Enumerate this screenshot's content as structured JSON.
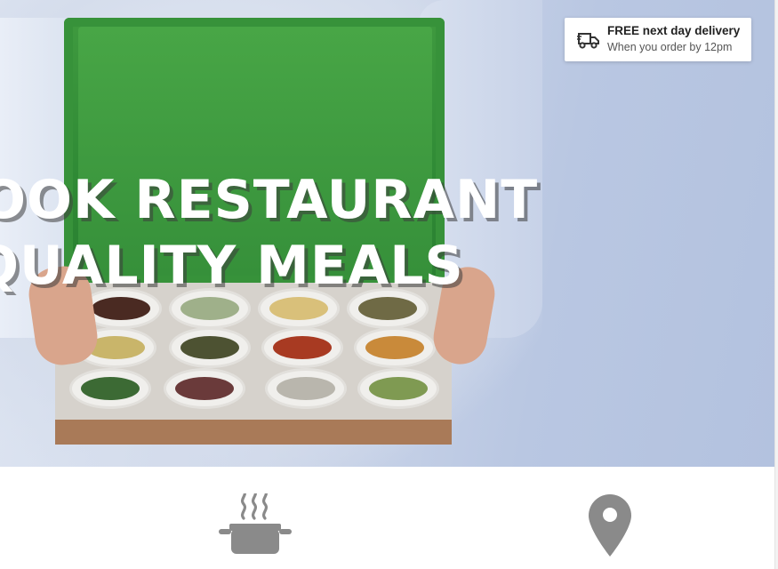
{
  "hero": {
    "headline_line1": "OOK RESTAURANT",
    "headline_line2": "QUALITY MEALS",
    "image_alt": "Person holding an open green box of spice and sauce pots"
  },
  "delivery_badge": {
    "title": "FREE next day delivery",
    "subtitle": "When you order by 12pm",
    "icon": "truck-icon"
  },
  "features": [
    {
      "icon": "cooking-pot-icon"
    },
    {
      "icon": "location-pin-icon"
    }
  ],
  "colors": {
    "hero_bg": "#c6d1e7",
    "box_green": "#37923a",
    "headline_text": "#ffffff",
    "icon_gray": "#8a8a8a"
  }
}
